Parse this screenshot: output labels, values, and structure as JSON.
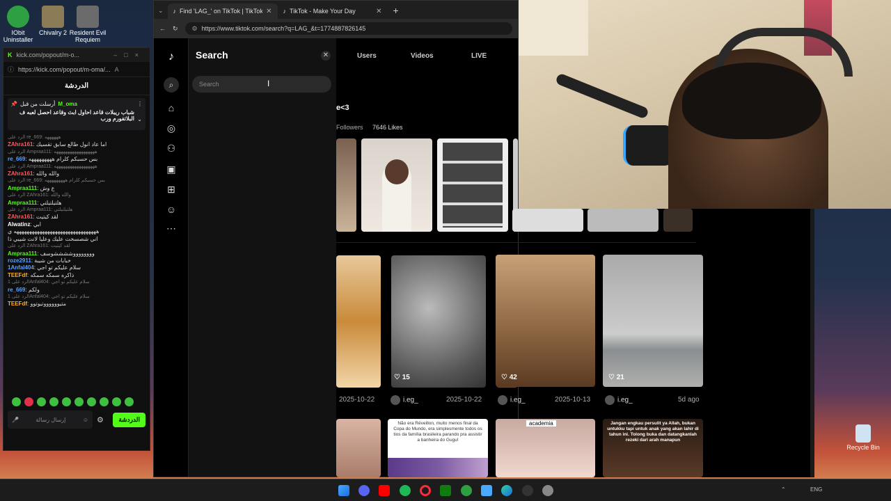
{
  "desktop": {
    "icons": [
      {
        "label": "IObit Uninstaller",
        "color": "#2ea043"
      },
      {
        "label": "Chivalry 2",
        "color": "#8a7a56"
      },
      {
        "label": "Resident Evil Requiem",
        "color": "#6b6b6b"
      }
    ],
    "recycle_bin": "Recycle Bin"
  },
  "kick": {
    "window_title": "kick.com/popout/m-o...",
    "url": "https://kick.com/popout/m-oma/...",
    "chat_title": "الدردشة",
    "pinned": {
      "by_prefix": "أرسلت من قبل",
      "by_user": "M_oma",
      "text": "شباب ريبلات قاعد احاول ابث وقاعد احصل لعبه ف البلاتفورم ورب"
    },
    "messages": [
      {
        "kind": "reply",
        "text": "الرد على re_669: ههههههه"
      },
      {
        "kind": "msg",
        "user": "ZAhra161",
        "color": "#ff5a5a",
        "text": "اما عاد انول طالع سابق تقسيك"
      },
      {
        "kind": "reply",
        "text": "الرد على Ampraa111: ههههههههههههههههههه"
      },
      {
        "kind": "msg",
        "user": "re_669",
        "color": "#5aa0ff",
        "text": "بس حسبكم كلرام هههههههههه"
      },
      {
        "kind": "reply",
        "text": "الرد على Ampraa111: ههههههههههههههههههه"
      },
      {
        "kind": "msg",
        "user": "ZAhra161",
        "color": "#ff5a5a",
        "text": "والله والله"
      },
      {
        "kind": "reply",
        "text": "الرد على re_669: بس حسبكم كلرام هههههههههه"
      },
      {
        "kind": "msg",
        "user": "Ampraa111",
        "color": "#53fc18",
        "text": "ع وش"
      },
      {
        "kind": "reply",
        "text": "الرد على ZAhra161: والله والله"
      },
      {
        "kind": "msg",
        "user": "Ampraa111",
        "color": "#53fc18",
        "text": "هلتيلتيلتي"
      },
      {
        "kind": "reply",
        "text": "الرد على Ampraa111: هلتيلتيلتي"
      },
      {
        "kind": "msg",
        "user": "ZAhra161",
        "color": "#ff5a5a",
        "text": "لقد كيتيت"
      },
      {
        "kind": "msg",
        "user": "Alwatinz",
        "color": "#ffffff",
        "text": "ابي"
      },
      {
        "kind": "msg",
        "user": "",
        "color": "#ffffff",
        "text": "ههههههههههههههههههههههههههههههههه ي"
      },
      {
        "kind": "msg",
        "user": "",
        "color": "#ffffff",
        "text": "اني شصسخت عليك وعليا لانت شيبي ذا"
      },
      {
        "kind": "reply",
        "text": "الرد على ZAhra161: لقد كيتيت"
      },
      {
        "kind": "msg",
        "user": "Ampraa111",
        "color": "#53fc18",
        "text": "ووووووووششششوسف"
      },
      {
        "kind": "msg",
        "user": "roze2911",
        "color": "#5aa0ff",
        "text": "خبابات من شيبة"
      },
      {
        "kind": "msg",
        "user": "1Anfal404",
        "color": "#5aa0ff",
        "text": "سلام عليكم تو اجي"
      },
      {
        "kind": "msg",
        "user": "TEEFdf",
        "color": "#ffb020",
        "text": "ذاكره سمكه سمكه"
      },
      {
        "kind": "reply",
        "text": "الرد على 1Anfal404: سلام عليكم تو اجي"
      },
      {
        "kind": "msg",
        "user": "re_669",
        "color": "#5aa0ff",
        "text": "ولكم"
      },
      {
        "kind": "reply",
        "text": "الرد على 1Anfal404: سلام عليكم تو اجي"
      },
      {
        "kind": "msg",
        "user": "TEEFdf",
        "color": "#ffb020",
        "text": "متيووووووتيوتوو"
      }
    ],
    "input_placeholder": "إرسال رسالة",
    "send_label": "الدردشة"
  },
  "browser": {
    "tabs": [
      {
        "title": "Find 'LAG_' on TikTok | TikTok Sear",
        "active": true
      },
      {
        "title": "TikTok - Make Your Day",
        "active": false
      }
    ],
    "url": "https://www.tiktok.com/search?q=LAG_&t=1774887826145"
  },
  "tiktok": {
    "search_title": "Search",
    "search_placeholder": "Search",
    "tabs": [
      "Users",
      "Videos",
      "LIVE"
    ],
    "heart_text": "e<3",
    "followers": "Followers",
    "likes": "7646 Likes",
    "videos": [
      {
        "likes": "",
        "date": "2025-10-22",
        "user": ""
      },
      {
        "likes": "15",
        "date": "2025-10-22",
        "user": "i.eg_"
      },
      {
        "likes": "42",
        "date": "2025-10-13",
        "user": "i.eg_"
      },
      {
        "likes": "21",
        "date": "5d ago",
        "user": "i.eg_"
      }
    ],
    "overlay_texts": [
      "Não era Réveillon, muito menos final da Copa do Mundo, era simplesmente todos os tios da família brasileira parando pra assistir a banheira do Gugu!",
      "academia",
      "Jangan engkau persulit ya Allah, bukan untukku tapi untuk anak yang akan lahir di tahun ini. Tolong buka dan datangkanlah rezeki dari arah manapun"
    ]
  },
  "taskbar": {
    "lang": "ENG"
  }
}
